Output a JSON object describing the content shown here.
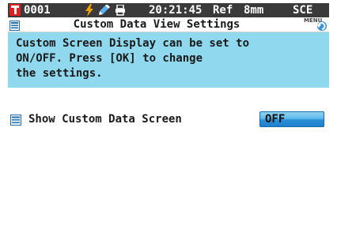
{
  "status_bar": {
    "sample_number": "0001",
    "time": "20:21:45",
    "reference_mode": "Ref",
    "aperture": "8mm",
    "spec_mode": "SCE",
    "icons": [
      "target-icon",
      "battery-power-icon",
      "pen-icon",
      "printer-icon"
    ],
    "bg_color": "#3a3a3a",
    "target_color": "#e02020",
    "bolt_color": "#f5a000"
  },
  "title_bar": {
    "title": "Custom Data View Settings",
    "menu_label": "MENU"
  },
  "info_panel": {
    "text": "Custom Screen Display can be set to\nON/OFF. Press [OK] to change\nthe settings.",
    "bg_color": "#8fd8ee"
  },
  "setting": {
    "label": "Show Custom Data Screen",
    "value": "OFF",
    "button_color": "#2b8fd6"
  }
}
